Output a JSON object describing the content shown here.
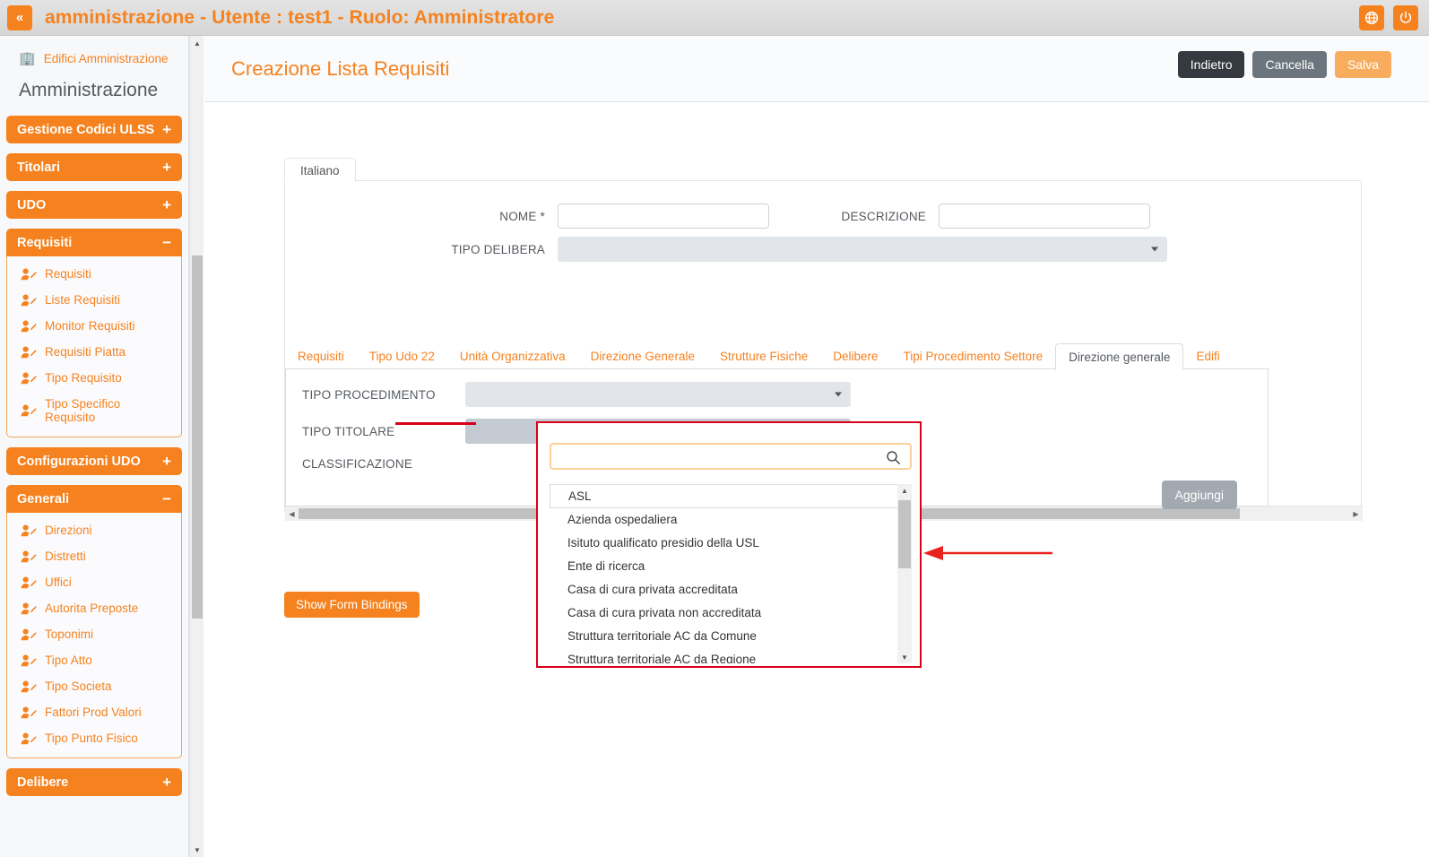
{
  "topbar": {
    "collapse_label": "«",
    "title": "amministrazione - Utente : test1 - Ruolo: Amministratore",
    "globe_icon": "globe-icon",
    "power_icon": "power-icon"
  },
  "sidebar": {
    "edifici_link": "Edifici Amministrazione",
    "heading": "Amministrazione",
    "groups": [
      {
        "label": "Gestione Codici ULSS",
        "sign": "+",
        "expanded": false,
        "items": []
      },
      {
        "label": "Titolari",
        "sign": "+",
        "expanded": false,
        "items": []
      },
      {
        "label": "UDO",
        "sign": "+",
        "expanded": false,
        "items": []
      },
      {
        "label": "Requisiti",
        "sign": "−",
        "expanded": true,
        "items": [
          "Requisiti",
          "Liste Requisiti",
          "Monitor Requisiti",
          "Requisiti Piatta",
          "Tipo Requisito",
          "Tipo Specifico Requisito"
        ]
      },
      {
        "label": "Configurazioni UDO",
        "sign": "+",
        "expanded": false,
        "items": []
      },
      {
        "label": "Generali",
        "sign": "−",
        "expanded": true,
        "items": [
          "Direzioni",
          "Distretti",
          "Uffici",
          "Autorita Preposte",
          "Toponimi",
          "Tipo Atto",
          "Tipo Societa",
          "Fattori Prod Valori",
          "Tipo Punto Fisico"
        ]
      },
      {
        "label": "Delibere",
        "sign": "+",
        "expanded": false,
        "items": []
      }
    ]
  },
  "page": {
    "title": "Creazione Lista Requisiti",
    "buttons": {
      "back": "Indietro",
      "cancel": "Cancella",
      "save": "Salva"
    }
  },
  "form": {
    "lang_tab": "Italiano",
    "nome_label": "NOME *",
    "nome_value": "",
    "descrizione_label": "DESCRIZIONE",
    "descrizione_value": "",
    "tipo_delibera_label": "TIPO DELIBERA",
    "tipo_delibera_value": ""
  },
  "tabs": {
    "items": [
      "Requisiti",
      "Tipo Udo 22",
      "Unità Organizzativa",
      "Direzione Generale",
      "Strutture Fisiche",
      "Delibere",
      "Tipi Procedimento Settore",
      "Direzione generale",
      "Edifi"
    ],
    "active_index": 7
  },
  "tabpanel": {
    "tipo_procedimento_label": "TIPO PROCEDIMENTO",
    "tipo_procedimento_value": "",
    "tipo_titolare_label": "TIPO TITOLARE",
    "tipo_titolare_value": "",
    "classificazione_label": "CLASSIFICAZIONE",
    "add_button": "Aggiungi"
  },
  "dropdown": {
    "search_value": "",
    "search_placeholder": "",
    "search_icon": "search-icon",
    "options": [
      "ASL",
      "Azienda ospedaliera",
      "Isituto qualificato presidio della USL",
      "Ente di ricerca",
      "Casa di cura privata accreditata",
      "Casa di cura privata non accreditata",
      "Struttura territoriale AC da Comune",
      "Struttura territoriale AC da Regione"
    ],
    "highlighted_index": 0
  },
  "footer": {
    "show_form_bindings": "Show Form Bindings"
  },
  "colors": {
    "accent_orange": "#f5821f",
    "annotation_red": "#d9001b",
    "save_orange": "#f8ad5e",
    "dark_button": "#343a40",
    "grey_button": "#6c757d"
  }
}
